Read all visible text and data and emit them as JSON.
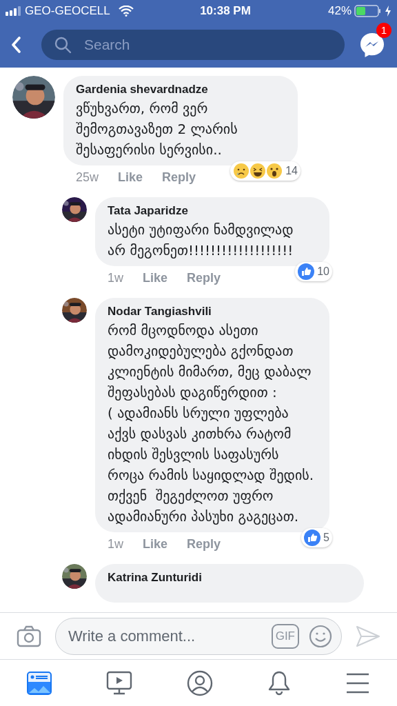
{
  "status_bar": {
    "carrier": "GEO-GEOCELL",
    "time": "10:38 PM",
    "battery": "42%"
  },
  "nav": {
    "search_placeholder": "Search",
    "messenger_badge": "1"
  },
  "comments": [
    {
      "author": "Gardenia shevardnadze",
      "text": "ვწუხვართ, რომ ვერ\nშემოგთავაზეთ 2 ლარის\nშესაფერისი სერვისი..",
      "age": "25w",
      "like": "Like",
      "reply": "Reply",
      "reactions": [
        {
          "kind": "sad"
        },
        {
          "kind": "haha"
        },
        {
          "kind": "wow"
        }
      ],
      "count": "14",
      "reply_level": false
    },
    {
      "author": "Tata Japaridze",
      "text": "ასეტი უტიფარი ნამდვილად\nარ მეგონეთ!!!!!!!!!!!!!!!!!!!",
      "age": "1w",
      "like": "Like",
      "reply": "Reply",
      "reactions": [
        {
          "kind": "like"
        }
      ],
      "count": "10",
      "reply_level": true
    },
    {
      "author": "Nodar Tangiashvili",
      "text": "რომ მცოდნოდა ასეთი\nდამოკიდებულება გქონდათ\nკლიენტის მიმართ, მეც დაბალ\nშეფასებას დაგიწერდით :\n( ადამიანს სრული უფლება\nაქვს დასვას კითხრა რატომ\nიხდის შესვლის საფასურს\nროცა რამის საყიდლად შედის.\nთქვენ  შეგეძლოთ უფრო\nადამიანური პასუხი გაგეცათ.",
      "age": "1w",
      "like": "Like",
      "reply": "Reply",
      "reactions": [
        {
          "kind": "like"
        }
      ],
      "count": "5",
      "reply_level": true
    },
    {
      "author": "Katrina Zunturidi",
      "reply_level": true
    }
  ],
  "composer": {
    "placeholder": "Write a comment...",
    "gif": "GIF"
  },
  "tabs": [
    {
      "kind": "news",
      "selected": true
    },
    {
      "kind": "video",
      "selected": false
    },
    {
      "kind": "profile",
      "selected": false
    },
    {
      "kind": "bell",
      "selected": false
    },
    {
      "kind": "menu",
      "selected": false
    }
  ]
}
